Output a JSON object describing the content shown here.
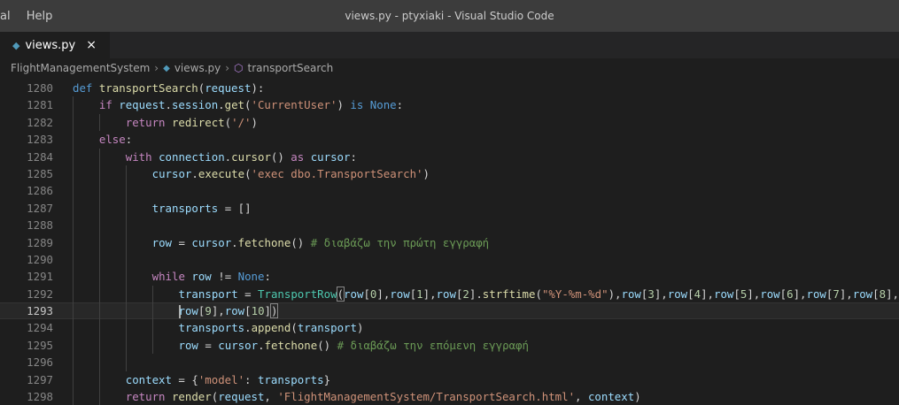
{
  "menu": [
    "al",
    "Help"
  ],
  "window_title": "views.py - ptyxiaki - Visual Studio Code",
  "tab": {
    "name": "views.py",
    "close": "×"
  },
  "breadcrumb": {
    "folder": "FlightManagementSystem",
    "file": "views.py",
    "symbol": "transportSearch",
    "sep": "›"
  },
  "current_line": 1293,
  "lines": [
    {
      "n": "1280",
      "indent": 0,
      "tokens": [
        [
          "kw",
          "def "
        ],
        [
          "fn",
          "transportSearch"
        ],
        [
          "",
          "("
        ],
        [
          "var",
          "request"
        ],
        [
          "",
          "):"
        ]
      ]
    },
    {
      "n": "1281",
      "indent": 1,
      "tokens": [
        [
          "ctl",
          "if "
        ],
        [
          "var",
          "request"
        ],
        [
          "",
          "."
        ],
        [
          "var",
          "session"
        ],
        [
          "",
          "."
        ],
        [
          "fn",
          "get"
        ],
        [
          "",
          "("
        ],
        [
          "str",
          "'CurrentUser'"
        ],
        [
          "",
          ") "
        ],
        [
          "kw",
          "is"
        ],
        [
          "",
          ""
        ],
        [
          "kw",
          " None"
        ],
        [
          "",
          ":"
        ]
      ]
    },
    {
      "n": "1282",
      "indent": 2,
      "tokens": [
        [
          "ctl",
          "return "
        ],
        [
          "fn",
          "redirect"
        ],
        [
          "",
          "("
        ],
        [
          "str",
          "'/'"
        ],
        [
          "",
          ")"
        ]
      ]
    },
    {
      "n": "1283",
      "indent": 1,
      "tokens": [
        [
          "ctl",
          "else"
        ],
        [
          "",
          ":"
        ]
      ]
    },
    {
      "n": "1284",
      "indent": 2,
      "tokens": [
        [
          "ctl",
          "with "
        ],
        [
          "var",
          "connection"
        ],
        [
          "",
          "."
        ],
        [
          "fn",
          "cursor"
        ],
        [
          "",
          "() "
        ],
        [
          "ctl",
          "as "
        ],
        [
          "var",
          "cursor"
        ],
        [
          "",
          ":"
        ]
      ]
    },
    {
      "n": "1285",
      "indent": 3,
      "tokens": [
        [
          "var",
          "cursor"
        ],
        [
          "",
          "."
        ],
        [
          "fn",
          "execute"
        ],
        [
          "",
          "("
        ],
        [
          "str",
          "'exec dbo.TransportSearch'"
        ],
        [
          "",
          ")"
        ]
      ]
    },
    {
      "n": "1286",
      "indent": 3,
      "tokens": []
    },
    {
      "n": "1287",
      "indent": 3,
      "tokens": [
        [
          "var",
          "transports"
        ],
        [
          "",
          " = []"
        ]
      ]
    },
    {
      "n": "1288",
      "indent": 3,
      "tokens": []
    },
    {
      "n": "1289",
      "indent": 3,
      "tokens": [
        [
          "var",
          "row"
        ],
        [
          "",
          " = "
        ],
        [
          "var",
          "cursor"
        ],
        [
          "",
          "."
        ],
        [
          "fn",
          "fetchone"
        ],
        [
          "",
          "() "
        ],
        [
          "cm",
          "# διαβάζω την πρώτη εγγραφή"
        ]
      ]
    },
    {
      "n": "1290",
      "indent": 3,
      "tokens": []
    },
    {
      "n": "1291",
      "indent": 3,
      "tokens": [
        [
          "ctl",
          "while "
        ],
        [
          "var",
          "row"
        ],
        [
          "",
          " != "
        ],
        [
          "kw",
          "None"
        ],
        [
          "",
          ":"
        ]
      ]
    },
    {
      "n": "1292",
      "indent": 4,
      "tokens": [
        [
          "var",
          "transport"
        ],
        [
          "",
          " = "
        ],
        [
          "cls",
          "TransportRow"
        ],
        [
          "bm",
          "("
        ],
        [
          "var",
          "row"
        ],
        [
          "",
          "["
        ],
        [
          "num",
          "0"
        ],
        [
          "",
          "],"
        ],
        [
          "var",
          "row"
        ],
        [
          "",
          "["
        ],
        [
          "num",
          "1"
        ],
        [
          "",
          "],"
        ],
        [
          "var",
          "row"
        ],
        [
          "",
          "["
        ],
        [
          "num",
          "2"
        ],
        [
          "",
          "]."
        ],
        [
          "fn",
          "strftime"
        ],
        [
          "",
          "("
        ],
        [
          "str",
          "\"%Y-%m-%d\""
        ],
        [
          "",
          "),"
        ],
        [
          "var",
          "row"
        ],
        [
          "",
          "["
        ],
        [
          "num",
          "3"
        ],
        [
          "",
          "],"
        ],
        [
          "var",
          "row"
        ],
        [
          "",
          "["
        ],
        [
          "num",
          "4"
        ],
        [
          "",
          "],"
        ],
        [
          "var",
          "row"
        ],
        [
          "",
          "["
        ],
        [
          "num",
          "5"
        ],
        [
          "",
          "],"
        ],
        [
          "var",
          "row"
        ],
        [
          "",
          "["
        ],
        [
          "num",
          "6"
        ],
        [
          "",
          "],"
        ],
        [
          "var",
          "row"
        ],
        [
          "",
          "["
        ],
        [
          "num",
          "7"
        ],
        [
          "",
          "],"
        ],
        [
          "var",
          "row"
        ],
        [
          "",
          "["
        ],
        [
          "num",
          "8"
        ],
        [
          "",
          "],"
        ]
      ]
    },
    {
      "n": "1293",
      "indent": 4,
      "tokens": [
        [
          "cursor",
          ""
        ],
        [
          "var",
          "row"
        ],
        [
          "",
          "["
        ],
        [
          "num",
          "9"
        ],
        [
          "",
          "],"
        ],
        [
          "var",
          "row"
        ],
        [
          "",
          "["
        ],
        [
          "num",
          "10"
        ],
        [
          "",
          "]"
        ],
        [
          "bm",
          ")"
        ]
      ]
    },
    {
      "n": "1294",
      "indent": 4,
      "tokens": [
        [
          "var",
          "transports"
        ],
        [
          "",
          "."
        ],
        [
          "fn",
          "append"
        ],
        [
          "",
          "("
        ],
        [
          "var",
          "transport"
        ],
        [
          "",
          ")"
        ]
      ]
    },
    {
      "n": "1295",
      "indent": 4,
      "tokens": [
        [
          "var",
          "row"
        ],
        [
          "",
          " = "
        ],
        [
          "var",
          "cursor"
        ],
        [
          "",
          "."
        ],
        [
          "fn",
          "fetchone"
        ],
        [
          "",
          "() "
        ],
        [
          "cm",
          "# διαβάζω την επόμενη εγγραφή"
        ]
      ]
    },
    {
      "n": "1296",
      "indent": 3,
      "tokens": []
    },
    {
      "n": "1297",
      "indent": 2,
      "tokens": [
        [
          "var",
          "context"
        ],
        [
          "",
          " = {"
        ],
        [
          "str",
          "'model'"
        ],
        [
          "",
          ": "
        ],
        [
          "var",
          "transports"
        ],
        [
          "",
          "}"
        ]
      ]
    },
    {
      "n": "1298",
      "indent": 2,
      "tokens": [
        [
          "ctl",
          "return "
        ],
        [
          "fn",
          "render"
        ],
        [
          "",
          "("
        ],
        [
          "var",
          "request"
        ],
        [
          "",
          ", "
        ],
        [
          "str",
          "'FlightManagementSystem/TransportSearch.html'"
        ],
        [
          "",
          ", "
        ],
        [
          "var",
          "context"
        ],
        [
          "",
          ")"
        ]
      ]
    }
  ]
}
